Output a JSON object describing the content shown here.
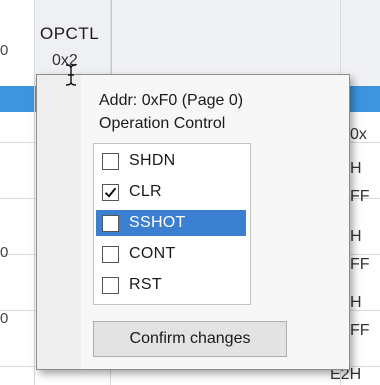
{
  "table": {
    "column_name": "OPCTL",
    "column_value": "0x2",
    "left_digits": [
      "0",
      "0",
      "0"
    ],
    "right_cells": [
      "0x",
      "H",
      "FF",
      "H",
      "FF",
      "H",
      "FF",
      "E2H"
    ]
  },
  "popup": {
    "address_line": "Addr: 0xF0 (Page 0)",
    "description_line": "Operation Control",
    "options": [
      {
        "label": "SHDN",
        "checked": false,
        "selected": false
      },
      {
        "label": "CLR",
        "checked": true,
        "selected": false
      },
      {
        "label": "SSHOT",
        "checked": false,
        "selected": true
      },
      {
        "label": "CONT",
        "checked": false,
        "selected": false
      },
      {
        "label": "RST",
        "checked": false,
        "selected": false
      }
    ],
    "confirm_label": "Confirm changes"
  },
  "colors": {
    "selection_blue": "#3d95e0",
    "option_highlight": "#3a7fd0"
  }
}
